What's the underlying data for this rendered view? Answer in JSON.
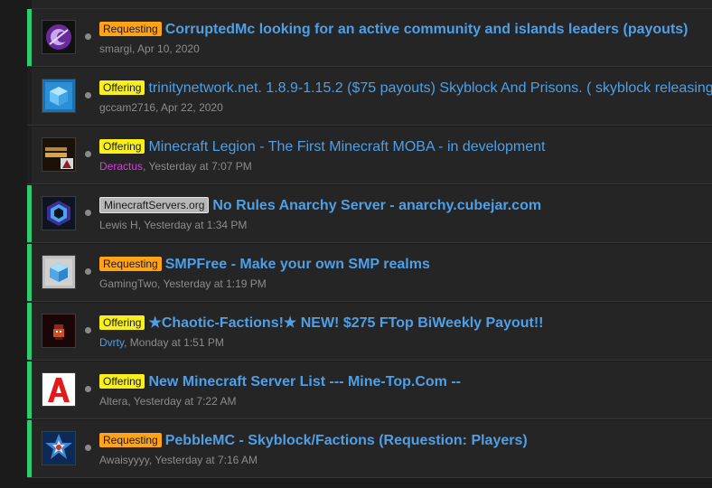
{
  "colors": {
    "unread_bar": "#2ecc71",
    "title_link": "#4f9fe6",
    "requesting_badge": "#ffa31a",
    "offering_badge": "#f7f01e"
  },
  "threads": [
    {
      "prefix": "Requesting",
      "title": "CorruptedMc looking for an active community and islands leaders (payouts)",
      "author": "smargi",
      "date": ", Apr 10, 2020",
      "unread": true,
      "avatar_icon": "corruptedmc-logo-icon"
    },
    {
      "prefix": "Offering",
      "title": "trinitynetwork.net. 1.8.9-1.15.2 ($75 payouts) Skyblock And Prisons. ( skyblock releasing",
      "author": "gccam2716",
      "date": ", Apr 22, 2020",
      "unread": false,
      "avatar_icon": "blue-cube-icon"
    },
    {
      "prefix": "Offering",
      "title": "Minecraft Legion - The First Minecraft MOBA - in development",
      "author": "Deractus",
      "date": ", Yesterday at 7:07 PM",
      "unread": false,
      "avatar_icon": "minecraft-legion-logo-icon"
    },
    {
      "prefix": "MinecraftServers.org",
      "title": "No Rules Anarchy Server - anarchy.cubejar.com",
      "author": "Lewis H",
      "date": ", Yesterday at 1:34 PM",
      "unread": true,
      "avatar_icon": "cubejar-logo-icon"
    },
    {
      "prefix": "Requesting",
      "title": "SMPFree - Make your own SMP realms",
      "author": "GamingTwo",
      "date": ", Yesterday at 1:19 PM",
      "unread": true,
      "avatar_icon": "blue-cube-icon"
    },
    {
      "prefix": "Offering",
      "title": "★Chaotic-Factions!★ NEW! $275 FTop BiWeekly Payout!!",
      "author": "Dvrty",
      "date": ", Monday at 1:51 PM",
      "unread": true,
      "avatar_icon": "chaotic-factions-avatar-icon"
    },
    {
      "prefix": "Offering",
      "title": "New Minecraft Server List --- Mine-Top.Com --",
      "author": "Altera",
      "date": ", Yesterday at 7:22 AM",
      "unread": true,
      "avatar_icon": "red-letter-a-icon"
    },
    {
      "prefix": "Requesting",
      "title": "PebbleMC - Skyblock/Factions (Requestion: Players)",
      "author": "Awaisyyyy",
      "date": ", Yesterday at 7:16 AM",
      "unread": true,
      "avatar_icon": "pebblemc-star-logo-icon"
    }
  ]
}
